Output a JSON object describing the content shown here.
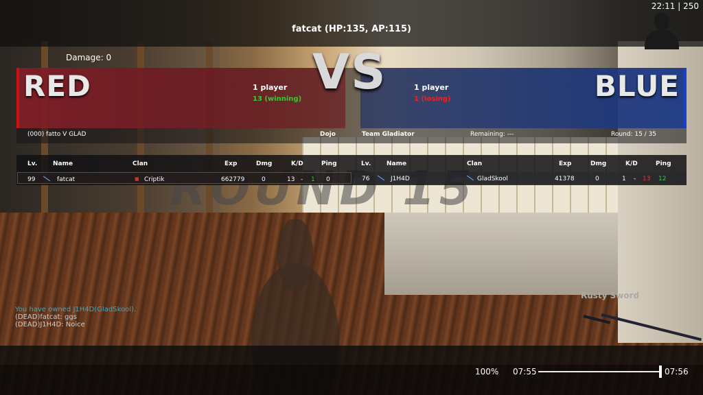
{
  "hud": {
    "player_title": "fatcat (HP:135, AP:115)",
    "clock": "22:11 | 250",
    "damage": "Damage: 0"
  },
  "scoreboard": {
    "vs": "VS",
    "red": {
      "name": "RED",
      "players": "1 player",
      "status": "13 (winning)",
      "status_color": "#3c3"
    },
    "blue": {
      "name": "BLUE",
      "players": "1 player",
      "status": "1 (losing)",
      "status_color": "#e22"
    },
    "info": {
      "match": "(000) fatto V GLAD",
      "map": "Dojo",
      "mode": "Team Gladiator",
      "remaining": "Remaining: ---",
      "round": "Round: 15 / 35"
    }
  },
  "table": {
    "headers": [
      "Lv.",
      "Name",
      "Clan",
      "Exp",
      "Dmg",
      "K/D",
      "Ping"
    ],
    "red_row": {
      "lv": "99",
      "name": "fatcat",
      "clan": "Criptik",
      "exp": "662779",
      "dmg": "0",
      "kills": "13",
      "sep": "-",
      "deaths": "1",
      "ping": "0"
    },
    "blue_row": {
      "lv": "76",
      "name": "J1H4D",
      "clan": "GladSkool",
      "exp": "41378",
      "dmg": "0",
      "kills": "1",
      "sep": "-",
      "deaths": "13",
      "ping": "12"
    }
  },
  "round_banner": "ROUND 15",
  "chat": [
    "You have owned J1H4D(GladSkool).",
    "(DEAD)fatcat: ggs",
    "(DEAD)J1H4D: Noice"
  ],
  "weapon": "Rusty Sword",
  "playback": {
    "zoom": "100%",
    "current_time": "07:55",
    "end_time": "07:56",
    "progress": 0.99
  },
  "icons": {
    "avatar": "player-silhouette-icon",
    "rank": "sword-rank-icon",
    "clan_red": "criptik-clan-icon",
    "clan_blue": "gladskool-clan-icon"
  }
}
